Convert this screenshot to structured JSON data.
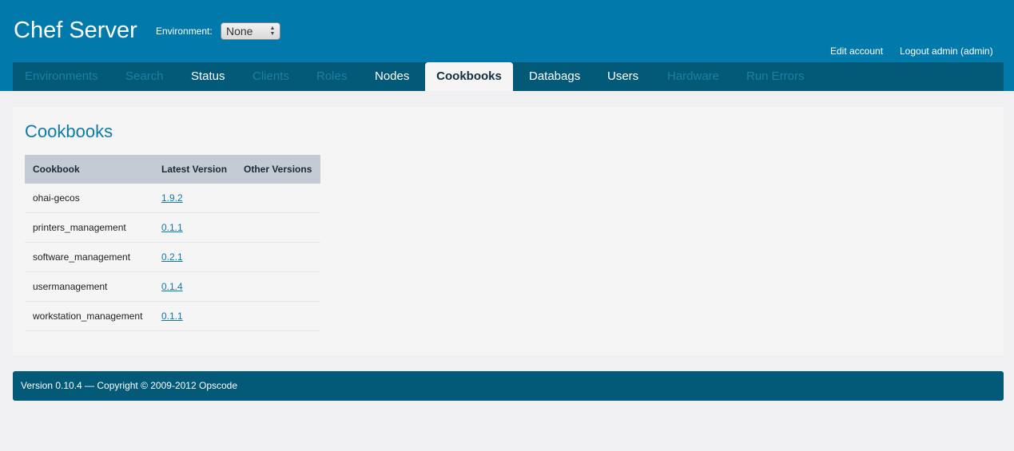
{
  "header": {
    "app_title": "Chef Server",
    "environment_label": "Environment:",
    "environment_selected": "None",
    "edit_account": "Edit account",
    "logout": "Logout admin (admin)"
  },
  "nav": {
    "tabs": [
      {
        "label": "Environments",
        "state": "disabled"
      },
      {
        "label": "Search",
        "state": "disabled"
      },
      {
        "label": "Status",
        "state": "enabled"
      },
      {
        "label": "Clients",
        "state": "disabled"
      },
      {
        "label": "Roles",
        "state": "disabled"
      },
      {
        "label": "Nodes",
        "state": "enabled"
      },
      {
        "label": "Cookbooks",
        "state": "active"
      },
      {
        "label": "Databags",
        "state": "enabled"
      },
      {
        "label": "Users",
        "state": "enabled"
      },
      {
        "label": "Hardware",
        "state": "disabled"
      },
      {
        "label": "Run Errors",
        "state": "disabled"
      }
    ]
  },
  "main": {
    "title": "Cookbooks",
    "table": {
      "columns": [
        "Cookbook",
        "Latest Version",
        "Other Versions"
      ],
      "rows": [
        {
          "name": "ohai-gecos",
          "latest": "1.9.2",
          "other": ""
        },
        {
          "name": "printers_management",
          "latest": "0.1.1",
          "other": ""
        },
        {
          "name": "software_management",
          "latest": "0.2.1",
          "other": ""
        },
        {
          "name": "usermanagement",
          "latest": "0.1.4",
          "other": ""
        },
        {
          "name": "workstation_management",
          "latest": "0.1.1",
          "other": ""
        }
      ]
    }
  },
  "footer": {
    "text": "Version 0.10.4 — Copyright © 2009-2012 Opscode"
  },
  "colors": {
    "header_bg": "#017aab",
    "nav_bg": "#025a78",
    "link": "#0e7ba8",
    "table_header_bg": "#c4cbd4"
  }
}
